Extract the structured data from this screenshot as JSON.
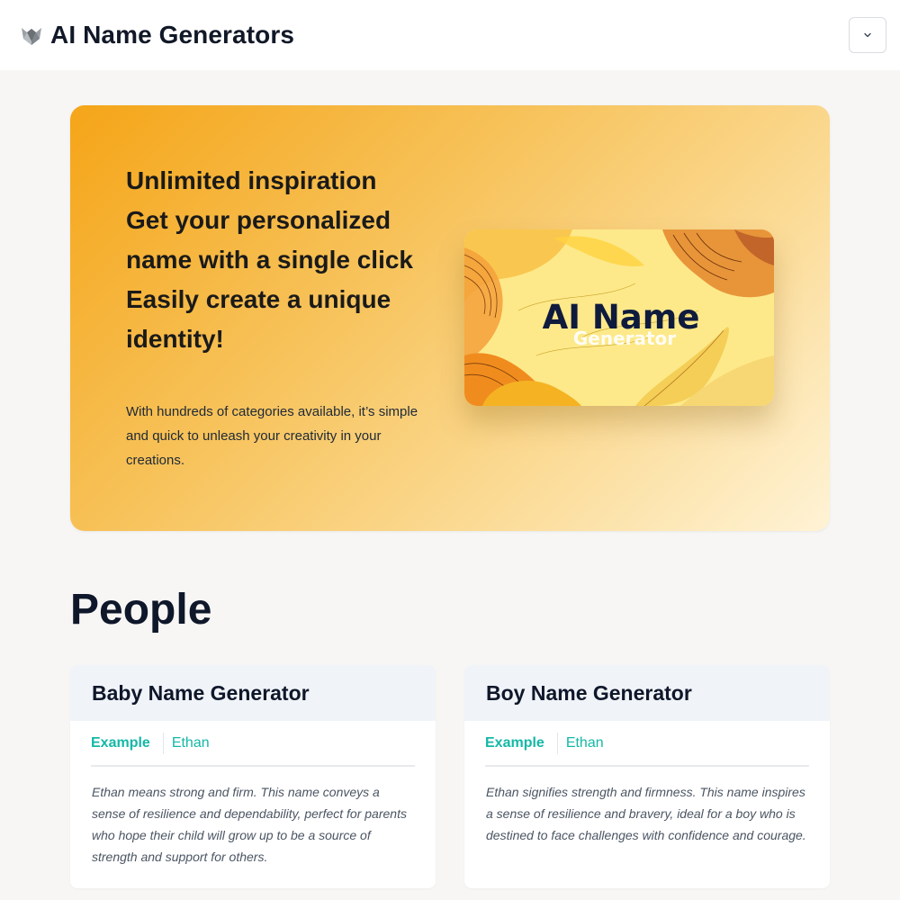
{
  "header": {
    "title": "AI Name Generators",
    "logo_icon": "wolf-logo-icon",
    "menu_icon": "chevron-down-icon"
  },
  "hero": {
    "heading_lines": [
      "Unlimited inspiration",
      "Get your personalized",
      "name with a single click",
      "Easily create a unique",
      "identity!"
    ],
    "description": "With hundreds of categories available, it’s simple and quick to unleash your creativity in your creations.",
    "image": {
      "title": "AI Name",
      "subtitle": "Generator"
    }
  },
  "colors": {
    "accent": "#14b8a6",
    "hero_start": "#f5a518",
    "hero_end": "#fff3d6"
  },
  "section": {
    "title": "People",
    "cards": [
      {
        "title": "Baby Name Generator",
        "example_label": "Example",
        "example_value": "Ethan",
        "description": "Ethan means strong and firm. This name conveys a sense of resilience and dependability, perfect for parents who hope their child will grow up to be a source of strength and support for others."
      },
      {
        "title": "Boy Name Generator",
        "example_label": "Example",
        "example_value": "Ethan",
        "description": "Ethan signifies strength and firmness. This name inspires a sense of resilience and bravery, ideal for a boy who is destined to face challenges with confidence and courage."
      }
    ]
  }
}
